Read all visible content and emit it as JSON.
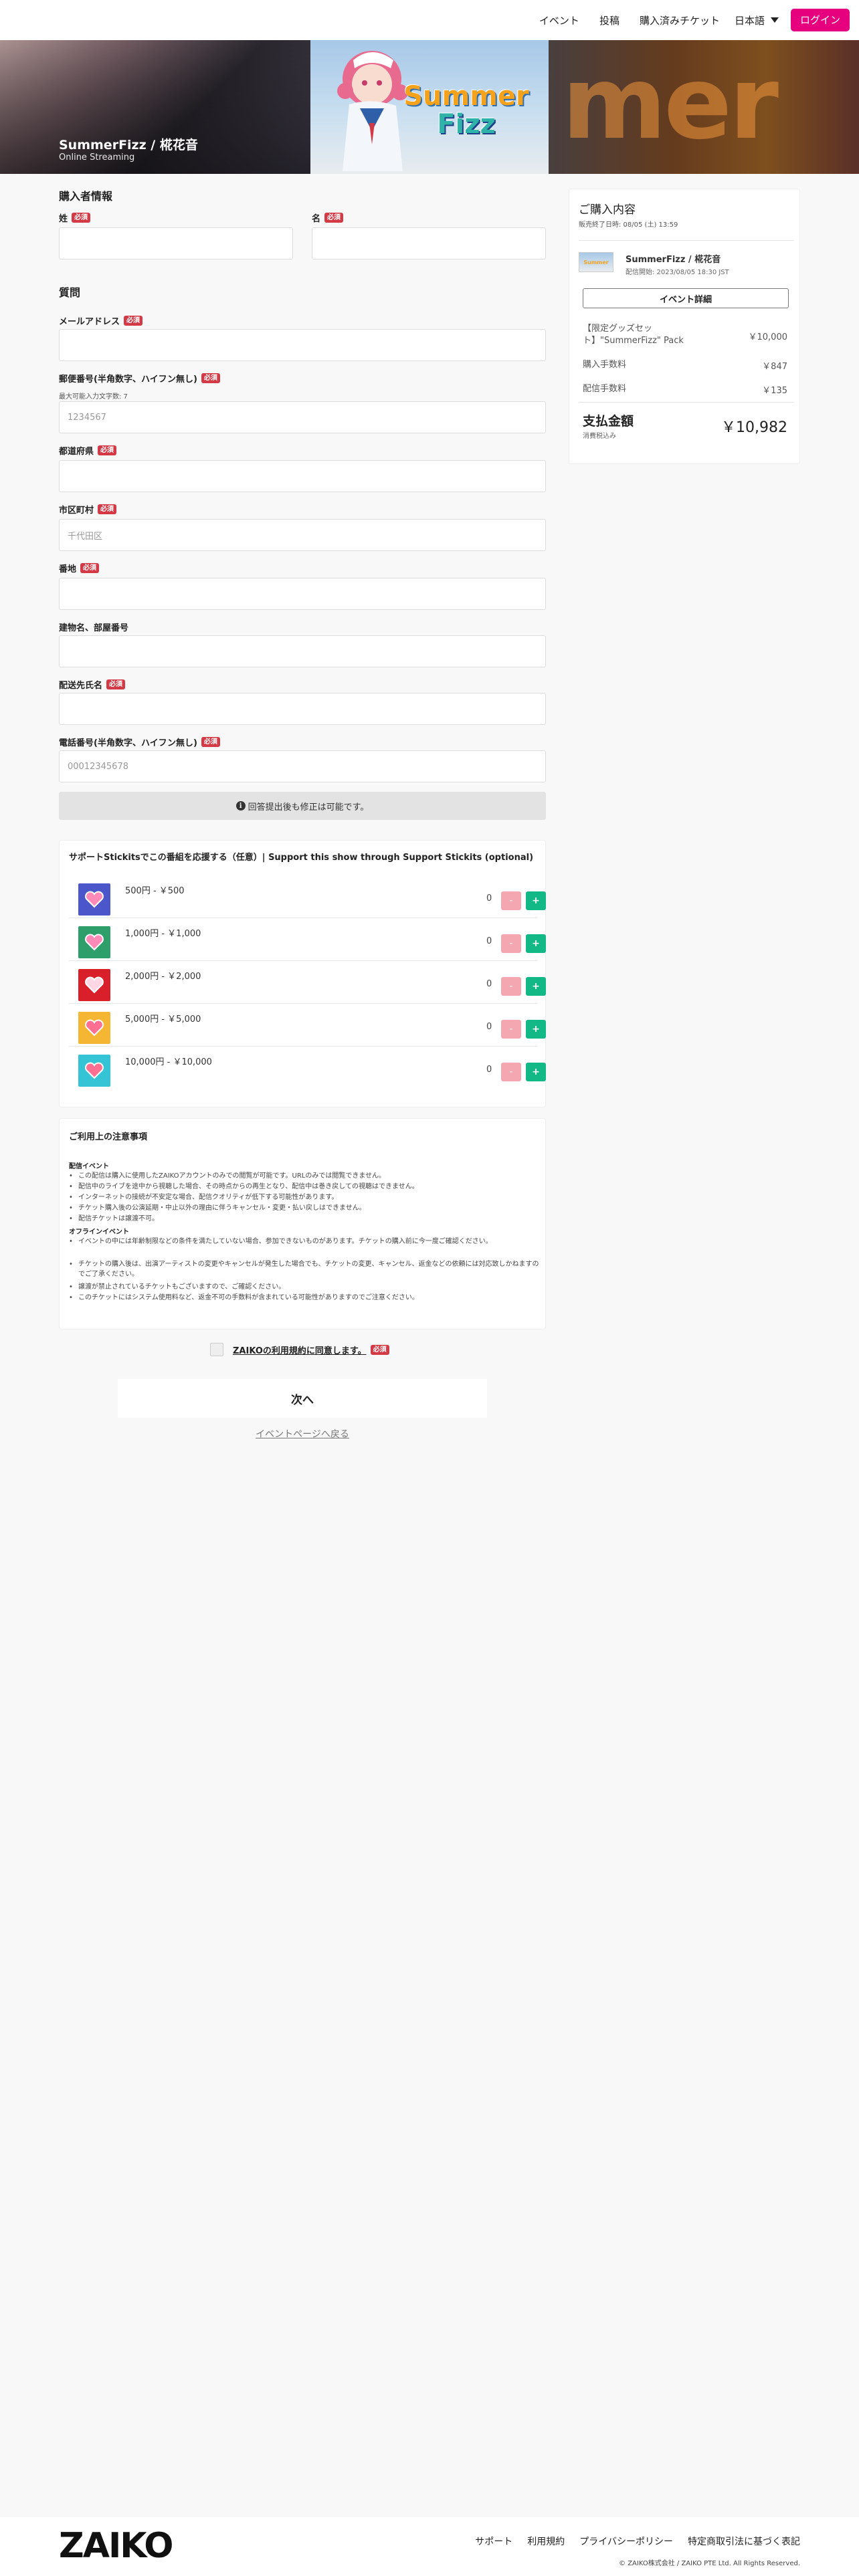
{
  "header": {
    "nav": [
      "イベント",
      "投稿",
      "購入済みチケット"
    ],
    "language": "日本語",
    "login": "ログイン"
  },
  "hero": {
    "title": "SummerFizz / 椛花音",
    "subtitle": "Online Streaming",
    "art_title_1": "Summer",
    "art_title_2": "Fizz",
    "bg_text": "mer"
  },
  "form": {
    "section_purchaser": "購入者情報",
    "last_name_label": "姓",
    "first_name_label": "名",
    "required_badge": "必須",
    "section_questions": "質問",
    "email_label": "メールアドレス",
    "postal_label": "郵便番号(半角数字、ハイフン無し)",
    "postal_hint": "最大可能入力文字数: 7",
    "postal_placeholder": "1234567",
    "prefecture_label": "都道府県",
    "city_label": "市区町村",
    "city_placeholder": "千代田区",
    "address_label": "番地",
    "building_label": "建物名、部屋番号",
    "recipient_label": "配送先氏名",
    "phone_label": "電話番号(半角数字、ハイフン無し)",
    "phone_placeholder": "00012345678",
    "notice": "回答提出後も修正は可能です。"
  },
  "support": {
    "title": "サポートStickitsでこの番組を応援する（任意）| Support this show through Support Stickits (optional)",
    "minus": "-",
    "plus": "+",
    "items": [
      {
        "label": "500円 - ￥500",
        "count": "0",
        "color": "#4a56c9"
      },
      {
        "label": "1,000円 - ￥1,000",
        "count": "0",
        "color": "#2e9e6a"
      },
      {
        "label": "2,000円 - ￥2,000",
        "count": "0",
        "color": "#d81f2a"
      },
      {
        "label": "5,000円 - ￥5,000",
        "count": "0",
        "color": "#f5b733"
      },
      {
        "label": "10,000円 - ￥10,000",
        "count": "0",
        "color": "#35c3d6"
      }
    ]
  },
  "terms": {
    "title": "ご利用上の注意事項",
    "streaming_heading": "配信イベント",
    "streaming_items": [
      "この配信は購入に使用したZAIKOアカウントのみでの閲覧が可能です。URLのみでは閲覧できません。",
      "配信中のライブを途中から視聴した場合、その時点からの再生となり、配信中は巻き戻しての視聴はできません。",
      "インターネットの接続が不安定な場合、配信クオリティが低下する可能性があります。",
      "チケット購入後の公演延期・中止以外の理由に伴うキャンセル・変更・払い戻しはできません。",
      "配信チケットは譲渡不可。"
    ],
    "offline_heading": "オフラインイベント",
    "offline_items": [
      "イベントの中には年齢制限などの条件を満たしていない場合、参加できないものがあります。チケットの購入前に今一度ご確認ください。",
      "チケットの購入後は、出演アーティストの変更やキャンセルが発生した場合でも、チケットの変更、キャンセル、返金などの依頼には対応致しかねますのでご了承ください。",
      "譲渡が禁止されているチケットもございますので、ご確認ください。",
      "このチケットにはシステム使用料など、返金不可の手数料が含まれている可能性がありますのでご注意ください。"
    ]
  },
  "agree": "ZAIKOの利用規約に同意します。",
  "next": "次へ",
  "back": "イベントページへ戻る",
  "sidebar": {
    "title": "ご購入内容",
    "deadline": "販売終了日時: 08/05 (土) 13:59",
    "event_name": "SummerFizz / 椛花音",
    "event_date": "配信開始: 2023/08/05 18:30 JST",
    "detail_button": "イベント詳細",
    "item_name_1": "【限定グッズセッ",
    "item_name_2": "ト】\"SummerFizz\" Pack",
    "item_price": "￥10,000",
    "fee_label": "購入手数料",
    "fee_price": "￥847",
    "shipping_label": "配信手数料",
    "shipping_price": "￥135",
    "total_label": "支払金額",
    "tax_note": "消費税込み",
    "total": "￥10,982"
  },
  "footer": {
    "logo": "ZAIKO",
    "links": [
      "サポート",
      "利用規約",
      "プライバシーポリシー",
      "特定商取引法に基づく表記"
    ],
    "copyright": "© ZAIKO株式会社 / ZAIKO PTE Ltd. All Rights Reserved."
  },
  "colors": {
    "accent": "#e6007e",
    "required": "#d33a45",
    "plus": "#12b886",
    "minus": "#f4a7b0"
  }
}
